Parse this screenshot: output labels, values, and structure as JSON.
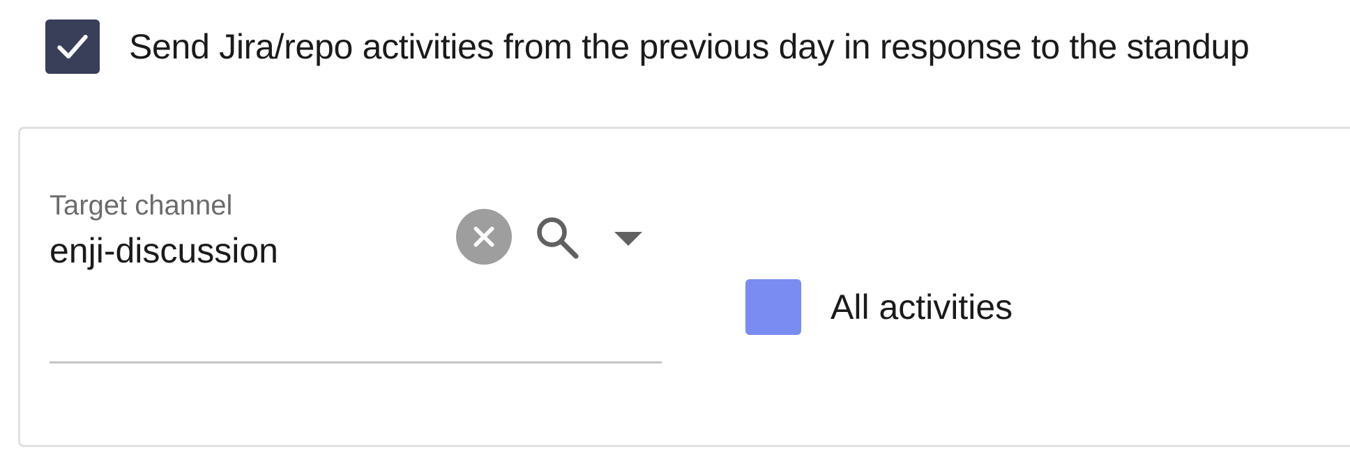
{
  "standup_option": {
    "checked": true,
    "label": "Send Jira/repo activities from the previous day in response to the standup"
  },
  "target_channel": {
    "label": "Target channel",
    "value": "enji-discussion",
    "clear_icon": "clear-circle-icon",
    "search_icon": "search-icon",
    "dropdown_icon": "caret-down-icon"
  },
  "activities_option": {
    "checked": false,
    "label": "All activities"
  },
  "colors": {
    "checkbox_checked": "#393e59",
    "checkbox_accent": "#7a8cf2",
    "clear_button": "#9e9e9e",
    "underline": "#c4c4c4",
    "card_border": "#e0e0e0"
  }
}
